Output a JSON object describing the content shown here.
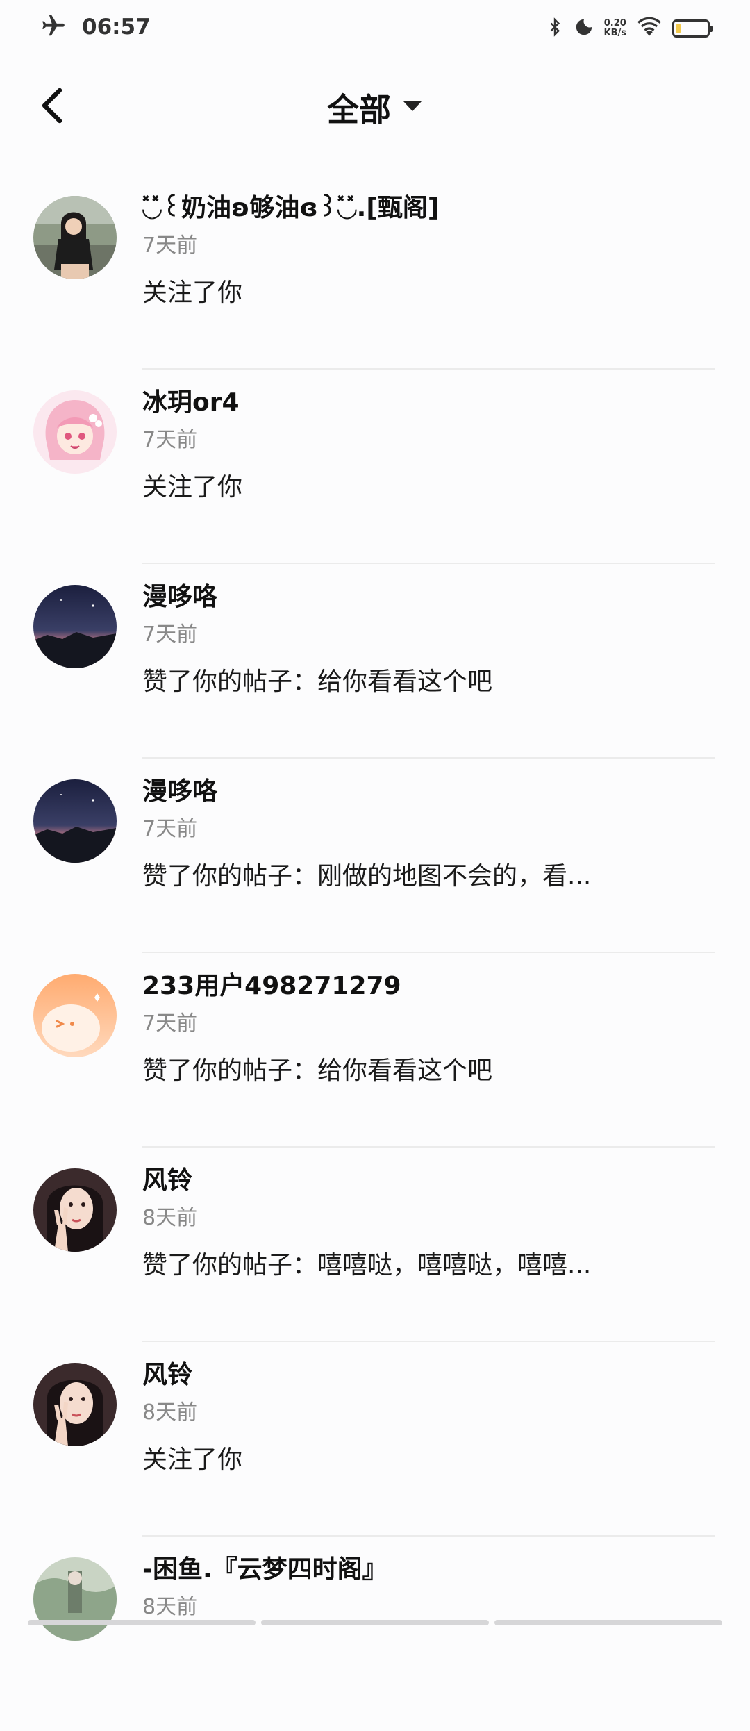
{
  "status_bar": {
    "time": "06:57",
    "net_speed_value": "0.20",
    "net_speed_unit": "KB/s",
    "icons": [
      "airplane-mode-icon",
      "bluetooth-icon",
      "do-not-disturb-icon",
      "wifi-icon",
      "battery-icon"
    ],
    "battery_color": "#f2c94c"
  },
  "header": {
    "back_icon": "chevron-left-icon",
    "title": "全部",
    "dropdown_icon": "caret-down-icon"
  },
  "notifications": [
    {
      "name": "◟̽◞̽꒰奶油ʚ够油ɞ꒱◟̽◞̽.[甄阁]",
      "time": "7天前",
      "action": "关注了你",
      "avatar": "photo-girl"
    },
    {
      "name": "冰玥or4",
      "time": "7天前",
      "action": "关注了你",
      "avatar": "anime-pink"
    },
    {
      "name": "漫哆咯",
      "time": "7天前",
      "action": "赞了你的帖子：给你看看这个吧",
      "avatar": "night-sky"
    },
    {
      "name": "漫哆咯",
      "time": "7天前",
      "action": "赞了你的帖子：刚做的地图不会的，看...",
      "avatar": "night-sky"
    },
    {
      "name": "233用户498271279",
      "time": "7天前",
      "action": "赞了你的帖子：给你看看这个吧",
      "avatar": "default-orange"
    },
    {
      "name": "风铃",
      "time": "8天前",
      "action": "赞了你的帖子：嘻嘻哒，嘻嘻哒，嘻嘻...",
      "avatar": "photo-peace"
    },
    {
      "name": "风铃",
      "time": "8天前",
      "action": "关注了你",
      "avatar": "photo-peace"
    },
    {
      "name": "-困鱼.『云梦四时阁』",
      "time": "8天前",
      "action": "",
      "avatar": "photo-outdoor"
    }
  ]
}
